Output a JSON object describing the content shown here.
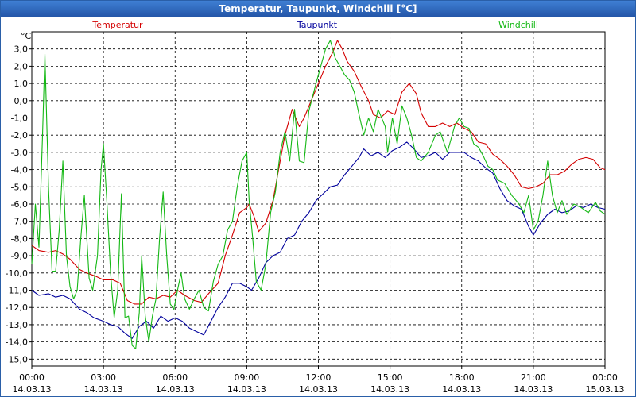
{
  "window": {
    "title": "Temperatur, Taupunkt, Windchill [°C]"
  },
  "colors": {
    "temperatur": "#d40000",
    "taupunkt": "#00009c",
    "windchill": "#14b814"
  },
  "chart_data": {
    "type": "line",
    "title": "Temperatur, Taupunkt, Windchill [°C]",
    "ylabel": "°C",
    "ylim": [
      -15.4,
      4.0
    ],
    "xlim": [
      0,
      24
    ],
    "grid": true,
    "legend_placement": "top",
    "yticks": [
      3,
      2,
      1,
      0,
      -1,
      -2,
      -3,
      -4,
      -5,
      -6,
      -7,
      -8,
      -9,
      -10,
      -11,
      -12,
      -13,
      -14,
      -15
    ],
    "ytick_labels": [
      "3,0",
      "2,0",
      "1,0",
      "0,0",
      "-1,0",
      "-2,0",
      "-3,0",
      "-4,0",
      "-5,0",
      "-6,0",
      "-7,0",
      "-8,0",
      "-9,0",
      "-10,0",
      "-11,0",
      "-12,0",
      "-13,0",
      "-14,0",
      "-15,0"
    ],
    "xticks": [
      {
        "x": 0,
        "time": "00:00",
        "date": "14.03.13"
      },
      {
        "x": 3,
        "time": "03:00",
        "date": "14.03.13"
      },
      {
        "x": 6,
        "time": "06:00",
        "date": "14.03.13"
      },
      {
        "x": 9,
        "time": "09:00",
        "date": "14.03.13"
      },
      {
        "x": 12,
        "time": "12:00",
        "date": "14.03.13"
      },
      {
        "x": 15,
        "time": "15:00",
        "date": "14.03.13"
      },
      {
        "x": 18,
        "time": "18:00",
        "date": "14.03.13"
      },
      {
        "x": 21,
        "time": "21:00",
        "date": "14.03.13"
      },
      {
        "x": 24,
        "time": "00:00",
        "date": "15.03.13"
      }
    ],
    "series": [
      {
        "name": "Temperatur",
        "color": "#d40000",
        "points": [
          [
            0,
            -8.4
          ],
          [
            0.3,
            -8.7
          ],
          [
            0.7,
            -8.8
          ],
          [
            1.0,
            -8.7
          ],
          [
            1.3,
            -8.9
          ],
          [
            1.6,
            -9.2
          ],
          [
            2.0,
            -9.8
          ],
          [
            2.3,
            -10.0
          ],
          [
            2.7,
            -10.2
          ],
          [
            3.0,
            -10.4
          ],
          [
            3.4,
            -10.4
          ],
          [
            3.7,
            -10.6
          ],
          [
            4.0,
            -11.6
          ],
          [
            4.3,
            -11.8
          ],
          [
            4.6,
            -11.8
          ],
          [
            4.9,
            -11.4
          ],
          [
            5.2,
            -11.5
          ],
          [
            5.5,
            -11.3
          ],
          [
            5.8,
            -11.4
          ],
          [
            6.1,
            -11.0
          ],
          [
            6.4,
            -11.3
          ],
          [
            6.8,
            -11.6
          ],
          [
            7.1,
            -11.7
          ],
          [
            7.4,
            -11.2
          ],
          [
            7.8,
            -10.6
          ],
          [
            8.1,
            -9.0
          ],
          [
            8.4,
            -7.8
          ],
          [
            8.7,
            -6.5
          ],
          [
            9.0,
            -6.2
          ],
          [
            9.1,
            -6.0
          ],
          [
            9.3,
            -6.7
          ],
          [
            9.5,
            -7.6
          ],
          [
            9.8,
            -7.1
          ],
          [
            10.1,
            -5.8
          ],
          [
            10.4,
            -3.5
          ],
          [
            10.6,
            -2.0
          ],
          [
            10.9,
            -0.5
          ],
          [
            11.2,
            -1.5
          ],
          [
            11.4,
            -1.0
          ],
          [
            11.7,
            0.0
          ],
          [
            12.0,
            1.0
          ],
          [
            12.3,
            2.0
          ],
          [
            12.6,
            2.8
          ],
          [
            12.8,
            3.5
          ],
          [
            13.0,
            3.0
          ],
          [
            13.2,
            2.3
          ],
          [
            13.5,
            1.7
          ],
          [
            13.8,
            0.8
          ],
          [
            14.1,
            0.0
          ],
          [
            14.3,
            -0.8
          ],
          [
            14.6,
            -1.0
          ],
          [
            14.9,
            -0.6
          ],
          [
            15.2,
            -0.8
          ],
          [
            15.5,
            0.5
          ],
          [
            15.8,
            1.0
          ],
          [
            16.1,
            0.4
          ],
          [
            16.3,
            -0.7
          ],
          [
            16.6,
            -1.5
          ],
          [
            16.9,
            -1.5
          ],
          [
            17.2,
            -1.3
          ],
          [
            17.5,
            -1.5
          ],
          [
            17.8,
            -1.3
          ],
          [
            18.1,
            -1.6
          ],
          [
            18.4,
            -1.8
          ],
          [
            18.7,
            -2.4
          ],
          [
            19.0,
            -2.5
          ],
          [
            19.3,
            -3.1
          ],
          [
            19.6,
            -3.4
          ],
          [
            19.9,
            -3.8
          ],
          [
            20.2,
            -4.3
          ],
          [
            20.5,
            -5.0
          ],
          [
            20.8,
            -5.1
          ],
          [
            21.1,
            -5.0
          ],
          [
            21.4,
            -4.8
          ],
          [
            21.7,
            -4.3
          ],
          [
            22.0,
            -4.3
          ],
          [
            22.3,
            -4.1
          ],
          [
            22.6,
            -3.7
          ],
          [
            22.9,
            -3.4
          ],
          [
            23.2,
            -3.3
          ],
          [
            23.5,
            -3.4
          ],
          [
            23.8,
            -3.9
          ],
          [
            24,
            -4.0
          ]
        ]
      },
      {
        "name": "Taupunkt",
        "color": "#00009c",
        "points": [
          [
            0,
            -11.0
          ],
          [
            0.3,
            -11.3
          ],
          [
            0.7,
            -11.2
          ],
          [
            1.0,
            -11.4
          ],
          [
            1.3,
            -11.3
          ],
          [
            1.6,
            -11.5
          ],
          [
            2.0,
            -12.1
          ],
          [
            2.3,
            -12.3
          ],
          [
            2.6,
            -12.6
          ],
          [
            3.0,
            -12.8
          ],
          [
            3.3,
            -13.0
          ],
          [
            3.6,
            -13.1
          ],
          [
            3.9,
            -13.5
          ],
          [
            4.2,
            -13.8
          ],
          [
            4.5,
            -13.1
          ],
          [
            4.8,
            -12.8
          ],
          [
            5.1,
            -13.2
          ],
          [
            5.4,
            -12.5
          ],
          [
            5.7,
            -12.8
          ],
          [
            6.0,
            -12.6
          ],
          [
            6.3,
            -12.8
          ],
          [
            6.6,
            -13.2
          ],
          [
            6.9,
            -13.4
          ],
          [
            7.2,
            -13.6
          ],
          [
            7.5,
            -12.8
          ],
          [
            7.8,
            -12.0
          ],
          [
            8.1,
            -11.4
          ],
          [
            8.4,
            -10.6
          ],
          [
            8.7,
            -10.6
          ],
          [
            9.0,
            -10.8
          ],
          [
            9.2,
            -11.0
          ],
          [
            9.5,
            -10.3
          ],
          [
            9.8,
            -9.4
          ],
          [
            10.1,
            -9.0
          ],
          [
            10.4,
            -8.8
          ],
          [
            10.7,
            -8.0
          ],
          [
            11.0,
            -7.8
          ],
          [
            11.3,
            -7.0
          ],
          [
            11.6,
            -6.5
          ],
          [
            11.9,
            -5.8
          ],
          [
            12.2,
            -5.4
          ],
          [
            12.5,
            -5.0
          ],
          [
            12.8,
            -4.9
          ],
          [
            13.1,
            -4.3
          ],
          [
            13.4,
            -3.8
          ],
          [
            13.7,
            -3.3
          ],
          [
            13.9,
            -2.8
          ],
          [
            14.2,
            -3.2
          ],
          [
            14.5,
            -3.0
          ],
          [
            14.8,
            -3.3
          ],
          [
            15.1,
            -2.9
          ],
          [
            15.4,
            -2.7
          ],
          [
            15.7,
            -2.4
          ],
          [
            16.0,
            -2.8
          ],
          [
            16.3,
            -3.3
          ],
          [
            16.6,
            -3.2
          ],
          [
            16.9,
            -3.0
          ],
          [
            17.2,
            -3.4
          ],
          [
            17.5,
            -3.0
          ],
          [
            17.8,
            -3.0
          ],
          [
            18.1,
            -3.0
          ],
          [
            18.4,
            -3.3
          ],
          [
            18.7,
            -3.5
          ],
          [
            19.0,
            -3.9
          ],
          [
            19.3,
            -4.2
          ],
          [
            19.6,
            -5.1
          ],
          [
            19.9,
            -5.8
          ],
          [
            20.2,
            -6.1
          ],
          [
            20.5,
            -6.3
          ],
          [
            20.8,
            -7.3
          ],
          [
            21.0,
            -7.8
          ],
          [
            21.3,
            -7.1
          ],
          [
            21.6,
            -6.6
          ],
          [
            21.9,
            -6.3
          ],
          [
            22.2,
            -6.5
          ],
          [
            22.5,
            -6.4
          ],
          [
            22.8,
            -6.1
          ],
          [
            23.1,
            -6.2
          ],
          [
            23.4,
            -6.0
          ],
          [
            23.7,
            -6.2
          ],
          [
            24,
            -6.3
          ]
        ]
      },
      {
        "name": "Windchill",
        "color": "#14b814",
        "points": [
          [
            0,
            -9.5
          ],
          [
            0.15,
            -6.0
          ],
          [
            0.3,
            -8.5
          ],
          [
            0.45,
            -2.0
          ],
          [
            0.55,
            2.7
          ],
          [
            0.7,
            -5.0
          ],
          [
            0.85,
            -9.9
          ],
          [
            1.0,
            -9.9
          ],
          [
            1.15,
            -7.5
          ],
          [
            1.3,
            -3.5
          ],
          [
            1.45,
            -9.0
          ],
          [
            1.6,
            -10.8
          ],
          [
            1.75,
            -11.5
          ],
          [
            1.9,
            -11.0
          ],
          [
            2.05,
            -8.0
          ],
          [
            2.2,
            -5.5
          ],
          [
            2.4,
            -10.3
          ],
          [
            2.55,
            -11.0
          ],
          [
            2.75,
            -9.0
          ],
          [
            2.9,
            -4.0
          ],
          [
            3.0,
            -2.5
          ],
          [
            3.15,
            -6.0
          ],
          [
            3.3,
            -10.0
          ],
          [
            3.45,
            -12.6
          ],
          [
            3.6,
            -11.0
          ],
          [
            3.75,
            -5.4
          ],
          [
            3.9,
            -12.6
          ],
          [
            4.05,
            -12.5
          ],
          [
            4.2,
            -14.2
          ],
          [
            4.35,
            -14.4
          ],
          [
            4.5,
            -12.3
          ],
          [
            4.6,
            -9.0
          ],
          [
            4.75,
            -12.5
          ],
          [
            4.9,
            -14.0
          ],
          [
            5.05,
            -12.5
          ],
          [
            5.2,
            -11.5
          ],
          [
            5.35,
            -8.0
          ],
          [
            5.5,
            -5.3
          ],
          [
            5.65,
            -9.0
          ],
          [
            5.8,
            -11.8
          ],
          [
            5.95,
            -12.1
          ],
          [
            6.1,
            -11.0
          ],
          [
            6.25,
            -10.0
          ],
          [
            6.4,
            -11.5
          ],
          [
            6.6,
            -12.1
          ],
          [
            6.8,
            -11.5
          ],
          [
            7.0,
            -11.0
          ],
          [
            7.2,
            -12.0
          ],
          [
            7.4,
            -12.2
          ],
          [
            7.6,
            -10.5
          ],
          [
            7.8,
            -9.5
          ],
          [
            8.0,
            -9.0
          ],
          [
            8.2,
            -7.5
          ],
          [
            8.4,
            -7.0
          ],
          [
            8.6,
            -5.0
          ],
          [
            8.8,
            -3.5
          ],
          [
            9.0,
            -3.0
          ],
          [
            9.1,
            -5.8
          ],
          [
            9.25,
            -8.0
          ],
          [
            9.4,
            -10.5
          ],
          [
            9.6,
            -11.0
          ],
          [
            9.8,
            -9.5
          ],
          [
            10.0,
            -6.5
          ],
          [
            10.2,
            -5.3
          ],
          [
            10.4,
            -3.0
          ],
          [
            10.6,
            -1.8
          ],
          [
            10.8,
            -3.5
          ],
          [
            11.0,
            -0.5
          ],
          [
            11.2,
            -3.5
          ],
          [
            11.4,
            -3.6
          ],
          [
            11.6,
            -0.6
          ],
          [
            11.9,
            1.0
          ],
          [
            12.1,
            2.0
          ],
          [
            12.3,
            3.0
          ],
          [
            12.5,
            3.5
          ],
          [
            12.7,
            2.5
          ],
          [
            12.9,
            2.0
          ],
          [
            13.1,
            1.5
          ],
          [
            13.3,
            1.2
          ],
          [
            13.5,
            0.5
          ],
          [
            13.7,
            -0.8
          ],
          [
            13.9,
            -2.0
          ],
          [
            14.1,
            -1.0
          ],
          [
            14.3,
            -1.8
          ],
          [
            14.5,
            -0.5
          ],
          [
            14.8,
            -1.5
          ],
          [
            14.9,
            -3.0
          ],
          [
            15.1,
            -1.0
          ],
          [
            15.3,
            -2.5
          ],
          [
            15.5,
            -0.3
          ],
          [
            15.7,
            -1.0
          ],
          [
            15.9,
            -2.0
          ],
          [
            16.1,
            -3.3
          ],
          [
            16.3,
            -3.5
          ],
          [
            16.6,
            -3.0
          ],
          [
            16.9,
            -2.0
          ],
          [
            17.1,
            -1.8
          ],
          [
            17.4,
            -3.0
          ],
          [
            17.7,
            -1.5
          ],
          [
            17.9,
            -1.0
          ],
          [
            18.1,
            -1.5
          ],
          [
            18.3,
            -1.6
          ],
          [
            18.5,
            -2.5
          ],
          [
            18.7,
            -2.7
          ],
          [
            18.9,
            -3.2
          ],
          [
            19.1,
            -3.8
          ],
          [
            19.3,
            -4.0
          ],
          [
            19.5,
            -4.6
          ],
          [
            19.8,
            -4.8
          ],
          [
            20.1,
            -5.5
          ],
          [
            20.4,
            -6.0
          ],
          [
            20.6,
            -6.5
          ],
          [
            20.8,
            -5.5
          ],
          [
            21.0,
            -7.5
          ],
          [
            21.2,
            -7.0
          ],
          [
            21.4,
            -5.5
          ],
          [
            21.6,
            -3.5
          ],
          [
            21.8,
            -5.5
          ],
          [
            22.0,
            -6.5
          ],
          [
            22.2,
            -5.8
          ],
          [
            22.4,
            -6.6
          ],
          [
            22.7,
            -6.0
          ],
          [
            23.0,
            -6.2
          ],
          [
            23.3,
            -6.5
          ],
          [
            23.6,
            -5.9
          ],
          [
            23.8,
            -6.4
          ],
          [
            24,
            -6.6
          ]
        ]
      }
    ]
  }
}
